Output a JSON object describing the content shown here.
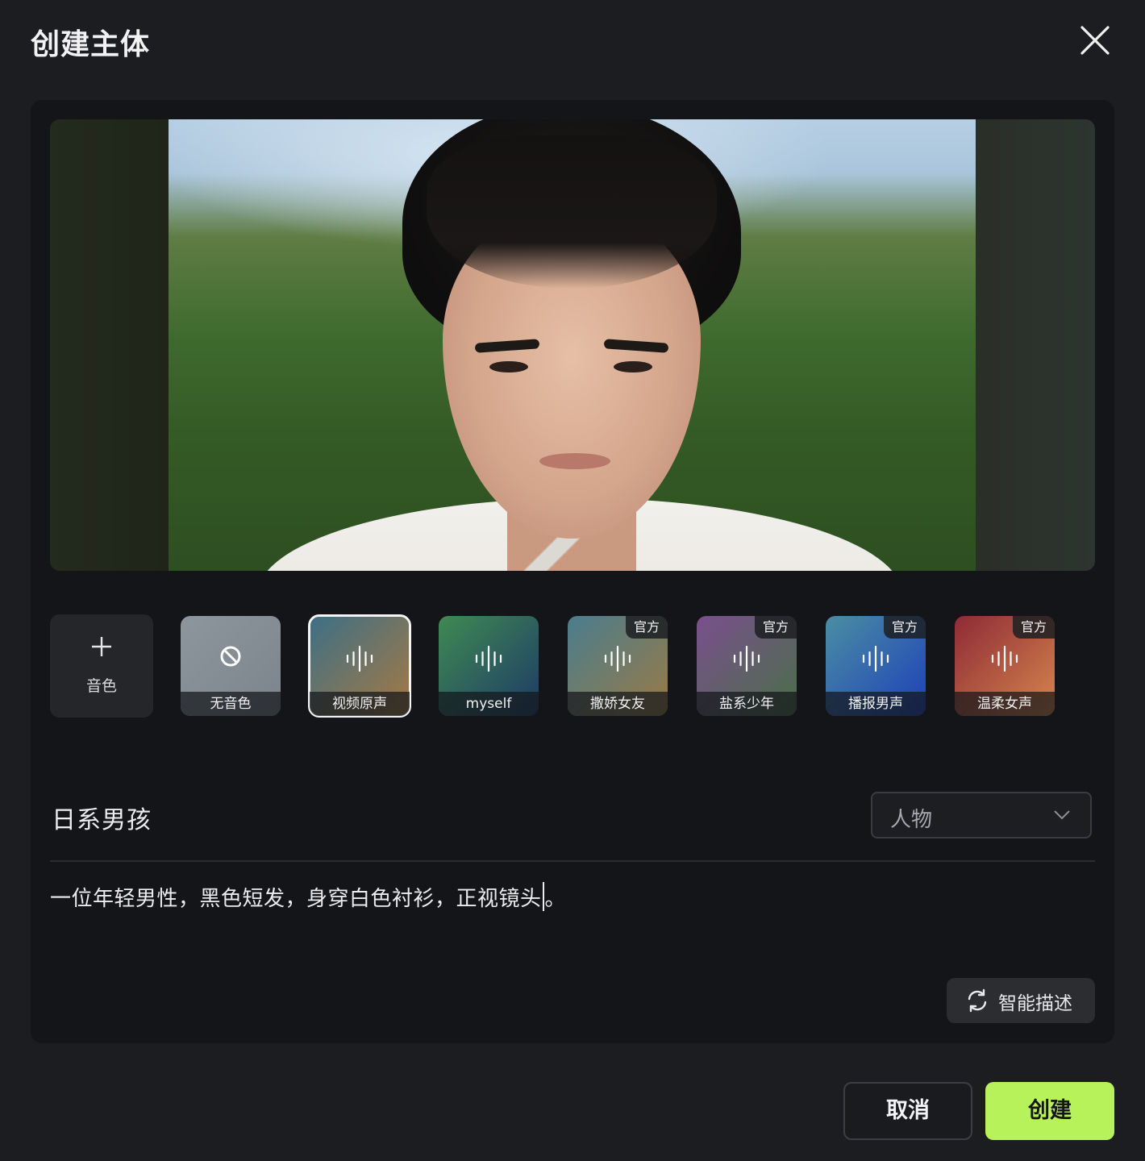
{
  "dialog": {
    "title": "创建主体",
    "close_icon": "close-icon"
  },
  "voices": {
    "add_label": "音色",
    "items": [
      {
        "name": "无音色",
        "icon": "ban-icon",
        "badge": "",
        "selected": false,
        "gradient": [
          "#8e969d",
          "#7b848c"
        ]
      },
      {
        "name": "视频原声",
        "icon": "audio-wave-icon",
        "badge": "",
        "selected": true,
        "gradient": [
          "#3d6f86",
          "#a67a42"
        ]
      },
      {
        "name": "myself",
        "icon": "audio-wave-icon",
        "badge": "",
        "selected": false,
        "gradient": [
          "#3f8a52",
          "#1e3a66"
        ]
      },
      {
        "name": "撒娇女友",
        "icon": "audio-wave-icon",
        "badge": "官方",
        "selected": false,
        "gradient": [
          "#4a7d8e",
          "#9a7a44"
        ]
      },
      {
        "name": "盐系少年",
        "icon": "audio-wave-icon",
        "badge": "官方",
        "selected": false,
        "gradient": [
          "#7a4f8e",
          "#4a6f48"
        ]
      },
      {
        "name": "播报男声",
        "icon": "audio-wave-icon",
        "badge": "官方",
        "selected": false,
        "gradient": [
          "#4a8ea3",
          "#1e3fb8"
        ]
      },
      {
        "name": "温柔女声",
        "icon": "audio-wave-icon",
        "badge": "官方",
        "selected": false,
        "gradient": [
          "#8e2a36",
          "#d7864e"
        ]
      }
    ]
  },
  "subject": {
    "name": "日系男孩",
    "category": "人物",
    "description_before_caret": "一位年轻男性，黑色短发，身穿白色衬衫，正视镜头",
    "description_after_caret": "。"
  },
  "smart_describe": {
    "label": "智能描述"
  },
  "footer": {
    "cancel_label": "取消",
    "create_label": "创建",
    "create_color": "#b7f25a"
  }
}
